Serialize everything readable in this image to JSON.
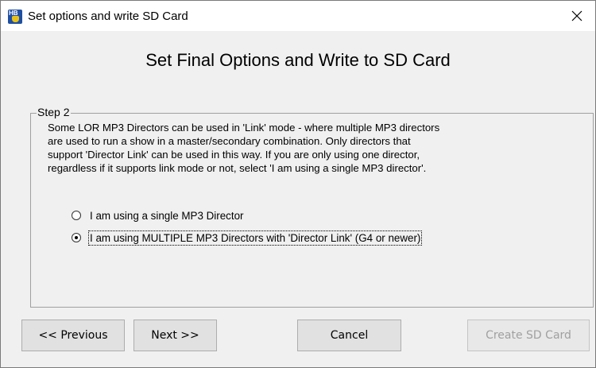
{
  "window": {
    "title": "Set options and write SD Card",
    "app_icon_text": "HB"
  },
  "heading": "Set Final Options and Write to SD Card",
  "step": {
    "label": "Step 2",
    "description_lines": [
      "Some LOR MP3 Directors can be used in 'Link' mode - where multiple MP3 directors",
      "are used to run a show in a master/secondary combination.  Only directors that",
      "support 'Director Link' can be used in this way.  If you are only using one director,",
      "regardless if it supports link mode or not, select 'I am using a single MP3 director'."
    ],
    "options": [
      {
        "label": "I am using a single MP3 Director",
        "selected": false
      },
      {
        "label": "I am using MULTIPLE MP3 Directors with 'Director Link' (G4 or newer)",
        "selected": true
      }
    ]
  },
  "buttons": {
    "previous": "<< Previous",
    "next": "Next >>",
    "cancel": "Cancel",
    "create": "Create SD Card",
    "create_enabled": false
  },
  "icons": {
    "close": "close-icon",
    "app": "app-icon"
  },
  "colors": {
    "dialog_bg": "#f0f0f0",
    "button_bg": "#e1e1e1",
    "disabled_text": "#a0a0a0"
  }
}
